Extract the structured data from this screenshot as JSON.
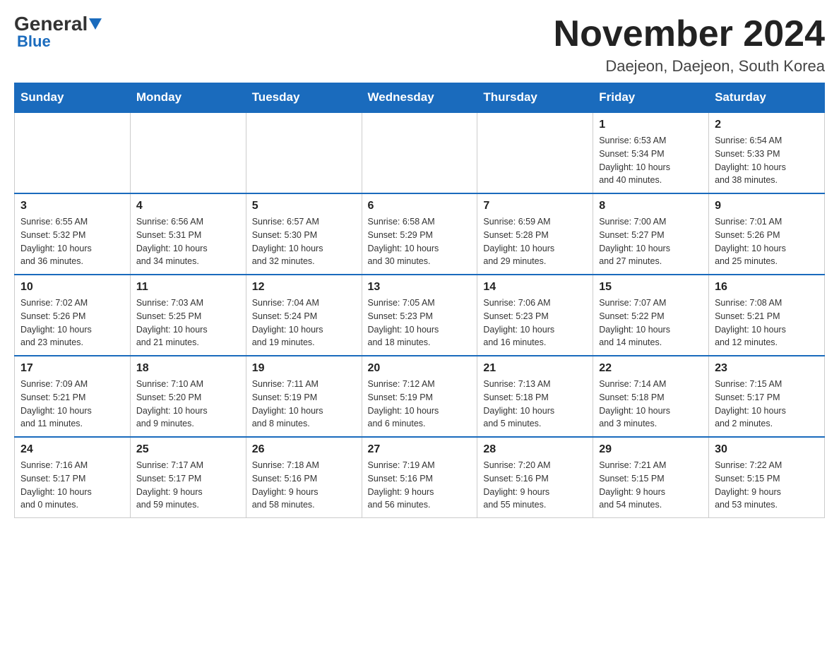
{
  "header": {
    "logo_general": "General",
    "logo_blue": "Blue",
    "month_title": "November 2024",
    "location": "Daejeon, Daejeon, South Korea"
  },
  "days_of_week": [
    "Sunday",
    "Monday",
    "Tuesday",
    "Wednesday",
    "Thursday",
    "Friday",
    "Saturday"
  ],
  "weeks": [
    {
      "days": [
        {
          "number": "",
          "info": "",
          "empty": true
        },
        {
          "number": "",
          "info": "",
          "empty": true
        },
        {
          "number": "",
          "info": "",
          "empty": true
        },
        {
          "number": "",
          "info": "",
          "empty": true
        },
        {
          "number": "",
          "info": "",
          "empty": true
        },
        {
          "number": "1",
          "info": "Sunrise: 6:53 AM\nSunset: 5:34 PM\nDaylight: 10 hours\nand 40 minutes."
        },
        {
          "number": "2",
          "info": "Sunrise: 6:54 AM\nSunset: 5:33 PM\nDaylight: 10 hours\nand 38 minutes."
        }
      ]
    },
    {
      "days": [
        {
          "number": "3",
          "info": "Sunrise: 6:55 AM\nSunset: 5:32 PM\nDaylight: 10 hours\nand 36 minutes."
        },
        {
          "number": "4",
          "info": "Sunrise: 6:56 AM\nSunset: 5:31 PM\nDaylight: 10 hours\nand 34 minutes."
        },
        {
          "number": "5",
          "info": "Sunrise: 6:57 AM\nSunset: 5:30 PM\nDaylight: 10 hours\nand 32 minutes."
        },
        {
          "number": "6",
          "info": "Sunrise: 6:58 AM\nSunset: 5:29 PM\nDaylight: 10 hours\nand 30 minutes."
        },
        {
          "number": "7",
          "info": "Sunrise: 6:59 AM\nSunset: 5:28 PM\nDaylight: 10 hours\nand 29 minutes."
        },
        {
          "number": "8",
          "info": "Sunrise: 7:00 AM\nSunset: 5:27 PM\nDaylight: 10 hours\nand 27 minutes."
        },
        {
          "number": "9",
          "info": "Sunrise: 7:01 AM\nSunset: 5:26 PM\nDaylight: 10 hours\nand 25 minutes."
        }
      ]
    },
    {
      "days": [
        {
          "number": "10",
          "info": "Sunrise: 7:02 AM\nSunset: 5:26 PM\nDaylight: 10 hours\nand 23 minutes."
        },
        {
          "number": "11",
          "info": "Sunrise: 7:03 AM\nSunset: 5:25 PM\nDaylight: 10 hours\nand 21 minutes."
        },
        {
          "number": "12",
          "info": "Sunrise: 7:04 AM\nSunset: 5:24 PM\nDaylight: 10 hours\nand 19 minutes."
        },
        {
          "number": "13",
          "info": "Sunrise: 7:05 AM\nSunset: 5:23 PM\nDaylight: 10 hours\nand 18 minutes."
        },
        {
          "number": "14",
          "info": "Sunrise: 7:06 AM\nSunset: 5:23 PM\nDaylight: 10 hours\nand 16 minutes."
        },
        {
          "number": "15",
          "info": "Sunrise: 7:07 AM\nSunset: 5:22 PM\nDaylight: 10 hours\nand 14 minutes."
        },
        {
          "number": "16",
          "info": "Sunrise: 7:08 AM\nSunset: 5:21 PM\nDaylight: 10 hours\nand 12 minutes."
        }
      ]
    },
    {
      "days": [
        {
          "number": "17",
          "info": "Sunrise: 7:09 AM\nSunset: 5:21 PM\nDaylight: 10 hours\nand 11 minutes."
        },
        {
          "number": "18",
          "info": "Sunrise: 7:10 AM\nSunset: 5:20 PM\nDaylight: 10 hours\nand 9 minutes."
        },
        {
          "number": "19",
          "info": "Sunrise: 7:11 AM\nSunset: 5:19 PM\nDaylight: 10 hours\nand 8 minutes."
        },
        {
          "number": "20",
          "info": "Sunrise: 7:12 AM\nSunset: 5:19 PM\nDaylight: 10 hours\nand 6 minutes."
        },
        {
          "number": "21",
          "info": "Sunrise: 7:13 AM\nSunset: 5:18 PM\nDaylight: 10 hours\nand 5 minutes."
        },
        {
          "number": "22",
          "info": "Sunrise: 7:14 AM\nSunset: 5:18 PM\nDaylight: 10 hours\nand 3 minutes."
        },
        {
          "number": "23",
          "info": "Sunrise: 7:15 AM\nSunset: 5:17 PM\nDaylight: 10 hours\nand 2 minutes."
        }
      ]
    },
    {
      "days": [
        {
          "number": "24",
          "info": "Sunrise: 7:16 AM\nSunset: 5:17 PM\nDaylight: 10 hours\nand 0 minutes."
        },
        {
          "number": "25",
          "info": "Sunrise: 7:17 AM\nSunset: 5:17 PM\nDaylight: 9 hours\nand 59 minutes."
        },
        {
          "number": "26",
          "info": "Sunrise: 7:18 AM\nSunset: 5:16 PM\nDaylight: 9 hours\nand 58 minutes."
        },
        {
          "number": "27",
          "info": "Sunrise: 7:19 AM\nSunset: 5:16 PM\nDaylight: 9 hours\nand 56 minutes."
        },
        {
          "number": "28",
          "info": "Sunrise: 7:20 AM\nSunset: 5:16 PM\nDaylight: 9 hours\nand 55 minutes."
        },
        {
          "number": "29",
          "info": "Sunrise: 7:21 AM\nSunset: 5:15 PM\nDaylight: 9 hours\nand 54 minutes."
        },
        {
          "number": "30",
          "info": "Sunrise: 7:22 AM\nSunset: 5:15 PM\nDaylight: 9 hours\nand 53 minutes."
        }
      ]
    }
  ]
}
